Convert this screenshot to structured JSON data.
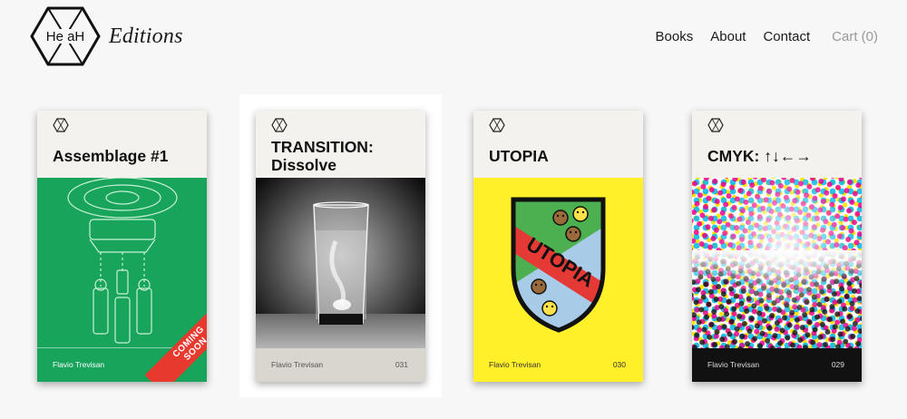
{
  "brand": {
    "logo_text": "He aH",
    "wordmark": "Editions"
  },
  "nav": {
    "items": [
      "Books",
      "About",
      "Contact"
    ],
    "cart": "Cart (0)"
  },
  "books": [
    {
      "title": "Assemblage #1",
      "author": "Flavio Trevisan",
      "number": "",
      "badge_line1": "COMING",
      "badge_line2": "SOON",
      "cover_color": "#18a45a"
    },
    {
      "title_line1": "TRANSITION:",
      "title_line2": "Dissolve",
      "author": "Flavio Trevisan",
      "number": "031",
      "cover_color": "#000000"
    },
    {
      "title": "UTOPIA",
      "author": "Flavio Trevisan",
      "number": "030",
      "art_text": "UTOPIA",
      "cover_color": "#fff029"
    },
    {
      "title": "CMYK: ↑↓←→",
      "author": "Flavio Trevisan",
      "number": "029",
      "cover_color": "#ffffff"
    }
  ],
  "colors": {
    "accent_red": "#e8392f",
    "green": "#18a45a",
    "yellow": "#fff029"
  }
}
